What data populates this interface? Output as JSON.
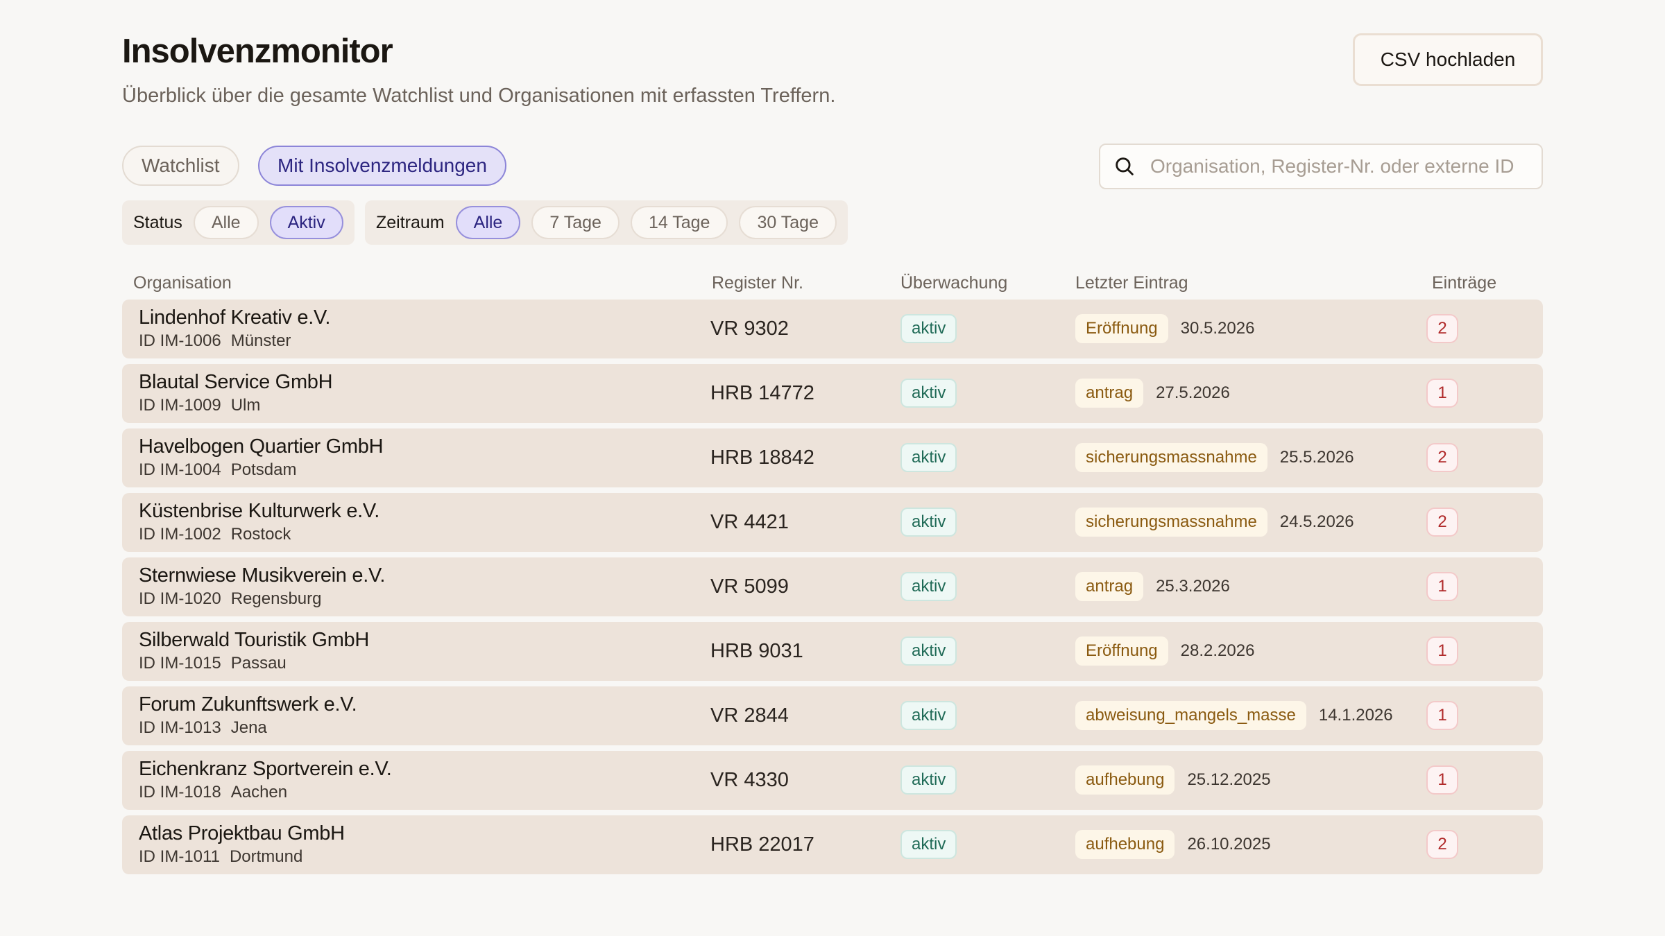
{
  "header": {
    "title": "Insolvenzmonitor",
    "subtitle": "Überblick über die gesamte Watchlist und Organisationen mit erfassten Treffern.",
    "upload_label": "CSV hochladen"
  },
  "views": {
    "watchlist_label": "Watchlist",
    "insolvency_label": "Mit Insolvenzmeldungen",
    "active": "Mit Insolvenzmeldungen"
  },
  "search": {
    "placeholder": "Organisation, Register-Nr. oder externe ID",
    "value": "",
    "icon": "search-icon"
  },
  "filters": {
    "status": {
      "label": "Status",
      "options": [
        "Alle",
        "Aktiv"
      ],
      "selected": "Aktiv"
    },
    "period": {
      "label": "Zeitraum",
      "options": [
        "Alle",
        "7 Tage",
        "14 Tage",
        "30 Tage"
      ],
      "selected": "Alle"
    }
  },
  "table": {
    "columns": [
      "Organisation",
      "Register Nr.",
      "Überwachung",
      "Letzter Eintrag",
      "Einträge"
    ],
    "rows": [
      {
        "name": "Lindenhof Kreativ e.V.",
        "id": "ID IM-1006",
        "city": "Münster",
        "register": "VR 9302",
        "monitoring": "aktiv",
        "last_type": "Eröffnung",
        "last_date": "30.5.2026",
        "count": "2"
      },
      {
        "name": "Blautal Service GmbH",
        "id": "ID IM-1009",
        "city": "Ulm",
        "register": "HRB 14772",
        "monitoring": "aktiv",
        "last_type": "antrag",
        "last_date": "27.5.2026",
        "count": "1"
      },
      {
        "name": "Havelbogen Quartier GmbH",
        "id": "ID IM-1004",
        "city": "Potsdam",
        "register": "HRB 18842",
        "monitoring": "aktiv",
        "last_type": "sicherungsmassnahme",
        "last_date": "25.5.2026",
        "count": "2"
      },
      {
        "name": "Küstenbrise Kulturwerk e.V.",
        "id": "ID IM-1002",
        "city": "Rostock",
        "register": "VR 4421",
        "monitoring": "aktiv",
        "last_type": "sicherungsmassnahme",
        "last_date": "24.5.2026",
        "count": "2"
      },
      {
        "name": "Sternwiese Musikverein e.V.",
        "id": "ID IM-1020",
        "city": "Regensburg",
        "register": "VR 5099",
        "monitoring": "aktiv",
        "last_type": "antrag",
        "last_date": "25.3.2026",
        "count": "1"
      },
      {
        "name": "Silberwald Touristik GmbH",
        "id": "ID IM-1015",
        "city": "Passau",
        "register": "HRB 9031",
        "monitoring": "aktiv",
        "last_type": "Eröffnung",
        "last_date": "28.2.2026",
        "count": "1"
      },
      {
        "name": "Forum Zukunftswerk e.V.",
        "id": "ID IM-1013",
        "city": "Jena",
        "register": "VR 2844",
        "monitoring": "aktiv",
        "last_type": "abweisung_mangels_masse",
        "last_date": "14.1.2026",
        "count": "1"
      },
      {
        "name": "Eichenkranz Sportverein e.V.",
        "id": "ID IM-1018",
        "city": "Aachen",
        "register": "VR 4330",
        "monitoring": "aktiv",
        "last_type": "aufhebung",
        "last_date": "25.12.2025",
        "count": "1"
      },
      {
        "name": "Atlas Projektbau GmbH",
        "id": "ID IM-1011",
        "city": "Dortmund",
        "register": "HRB 22017",
        "monitoring": "aktiv",
        "last_type": "aufhebung",
        "last_date": "26.10.2025",
        "count": "2"
      }
    ]
  }
}
